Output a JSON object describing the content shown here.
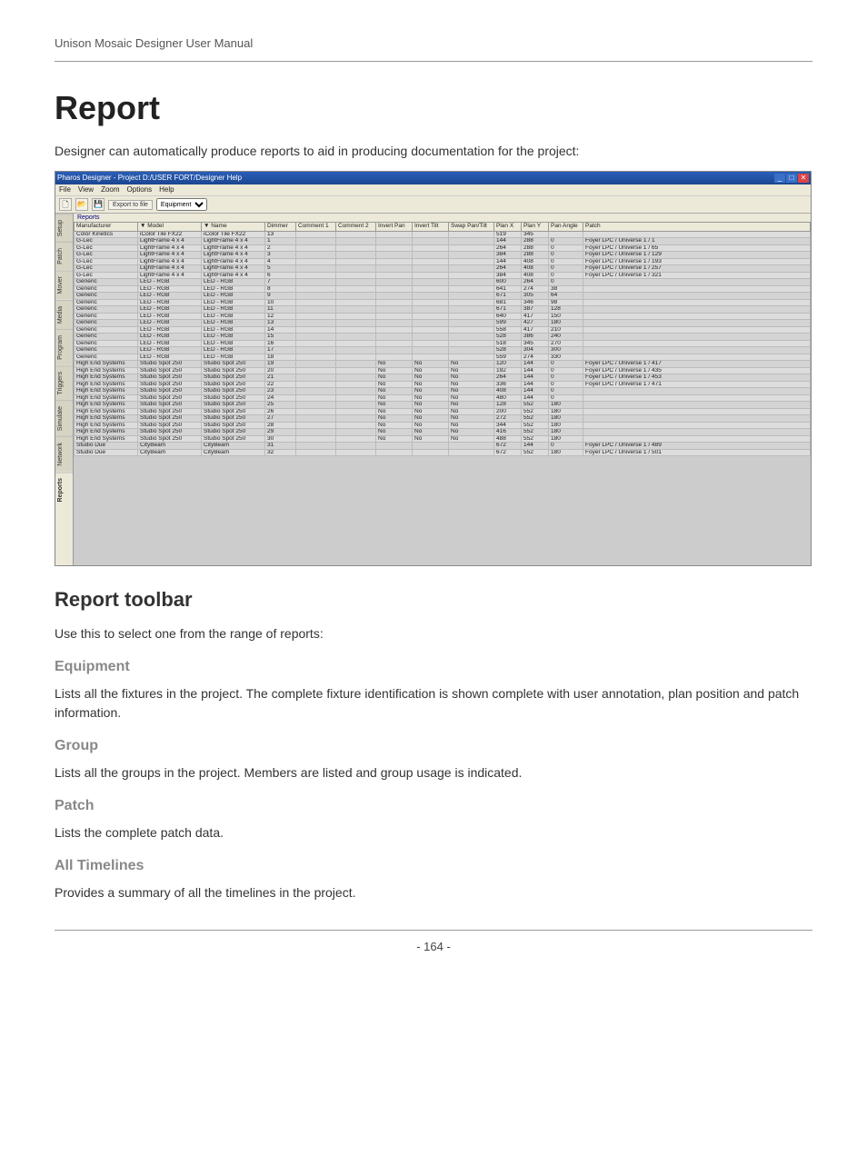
{
  "doc_header": "Unison Mosaic Designer User Manual",
  "title": "Report",
  "lead": "Designer can automatically produce reports to aid in producing documentation for the project:",
  "section_title": "Report toolbar",
  "section_lead": "Use this to select one from the range of reports:",
  "sub": {
    "equipment": {
      "title": "Equipment",
      "body": "Lists all the fixtures in the project. The complete fixture identification is shown complete with user annotation, plan position and patch information."
    },
    "group": {
      "title": "Group",
      "body": "Lists all the groups in the project. Members are listed and group usage is indicated."
    },
    "patch": {
      "title": "Patch",
      "body": "Lists the complete patch data."
    },
    "all_timelines": {
      "title": "All Timelines",
      "body": "Provides a summary of all the timelines in the project."
    }
  },
  "page_number": "- 164 -",
  "screenshot": {
    "titlebar": "Pharos Designer - Project D:/USER FORT/Designer Help",
    "menus": [
      "File",
      "View",
      "Zoom",
      "Options",
      "Help"
    ],
    "toolbar": {
      "export_label": "Export to file",
      "select_value": "Equipment"
    },
    "subtab": "Reports",
    "sidetabs": [
      "Setup",
      "Patch",
      "Mover",
      "Media",
      "Program",
      "Triggers",
      "Simulate",
      "Network",
      "Reports"
    ],
    "columns": [
      "Manufacturer",
      "▼ Model",
      "▼ Name",
      "Dimmer",
      "Comment 1",
      "Comment 2",
      "Invert Pan",
      "Invert Tilt",
      "Swap Pan/Tilt",
      "Plan X",
      "Plan Y",
      "Pan Angle",
      "Patch"
    ],
    "rows": [
      {
        "mfr": "Color Kinetics",
        "model": "iColor Tile FX22",
        "name": "iColor Tile FX22",
        "dim": "13",
        "c1": "",
        "c2": "",
        "ip": "",
        "it": "",
        "sp": "",
        "px": "519",
        "py": "345",
        "ang": "",
        "patch": ""
      },
      {
        "mfr": "G-Lec",
        "model": "LightFrame 4 x 4",
        "name": "LightFrame 4 x 4",
        "dim": "1",
        "c1": "",
        "c2": "",
        "ip": "",
        "it": "",
        "sp": "",
        "px": "144",
        "py": "288",
        "ang": "0",
        "patch": "Foyer LPC / Universe 1 / 1"
      },
      {
        "mfr": "G-Lec",
        "model": "LightFrame 4 x 4",
        "name": "LightFrame 4 x 4",
        "dim": "2",
        "c1": "",
        "c2": "",
        "ip": "",
        "it": "",
        "sp": "",
        "px": "264",
        "py": "288",
        "ang": "0",
        "patch": "Foyer LPC / Universe 1 / 65"
      },
      {
        "mfr": "G-Lec",
        "model": "LightFrame 4 x 4",
        "name": "LightFrame 4 x 4",
        "dim": "3",
        "c1": "",
        "c2": "",
        "ip": "",
        "it": "",
        "sp": "",
        "px": "384",
        "py": "288",
        "ang": "0",
        "patch": "Foyer LPC / Universe 1 / 129"
      },
      {
        "mfr": "G-Lec",
        "model": "LightFrame 4 x 4",
        "name": "LightFrame 4 x 4",
        "dim": "4",
        "c1": "",
        "c2": "",
        "ip": "",
        "it": "",
        "sp": "",
        "px": "144",
        "py": "408",
        "ang": "0",
        "patch": "Foyer LPC / Universe 1 / 193"
      },
      {
        "mfr": "G-Lec",
        "model": "LightFrame 4 x 4",
        "name": "LightFrame 4 x 4",
        "dim": "5",
        "c1": "",
        "c2": "",
        "ip": "",
        "it": "",
        "sp": "",
        "px": "264",
        "py": "408",
        "ang": "0",
        "patch": "Foyer LPC / Universe 1 / 257"
      },
      {
        "mfr": "G-Lec",
        "model": "LightFrame 4 x 4",
        "name": "LightFrame 4 x 4",
        "dim": "6",
        "c1": "",
        "c2": "",
        "ip": "",
        "it": "",
        "sp": "",
        "px": "384",
        "py": "408",
        "ang": "0",
        "patch": "Foyer LPC / Universe 1 / 321"
      },
      {
        "mfr": "Generic",
        "model": "LED - RGB",
        "name": "LED - RGB",
        "dim": "7",
        "c1": "",
        "c2": "",
        "ip": "",
        "it": "",
        "sp": "",
        "px": "600",
        "py": "264",
        "ang": "0",
        "patch": ""
      },
      {
        "mfr": "Generic",
        "model": "LED - RGB",
        "name": "LED - RGB",
        "dim": "8",
        "c1": "",
        "c2": "",
        "ip": "",
        "it": "",
        "sp": "",
        "px": "641",
        "py": "274",
        "ang": "38",
        "patch": ""
      },
      {
        "mfr": "Generic",
        "model": "LED - RGB",
        "name": "LED - RGB",
        "dim": "9",
        "c1": "",
        "c2": "",
        "ip": "",
        "it": "",
        "sp": "",
        "px": "671",
        "py": "305",
        "ang": "64",
        "patch": ""
      },
      {
        "mfr": "Generic",
        "model": "LED - RGB",
        "name": "LED - RGB",
        "dim": "10",
        "c1": "",
        "c2": "",
        "ip": "",
        "it": "",
        "sp": "",
        "px": "681",
        "py": "346",
        "ang": "98",
        "patch": ""
      },
      {
        "mfr": "Generic",
        "model": "LED - RGB",
        "name": "LED - RGB",
        "dim": "11",
        "c1": "",
        "c2": "",
        "ip": "",
        "it": "",
        "sp": "",
        "px": "671",
        "py": "387",
        "ang": "128",
        "patch": ""
      },
      {
        "mfr": "Generic",
        "model": "LED - RGB",
        "name": "LED - RGB",
        "dim": "12",
        "c1": "",
        "c2": "",
        "ip": "",
        "it": "",
        "sp": "",
        "px": "640",
        "py": "417",
        "ang": "150",
        "patch": ""
      },
      {
        "mfr": "Generic",
        "model": "LED - RGB",
        "name": "LED - RGB",
        "dim": "13",
        "c1": "",
        "c2": "",
        "ip": "",
        "it": "",
        "sp": "",
        "px": "599",
        "py": "427",
        "ang": "180",
        "patch": ""
      },
      {
        "mfr": "Generic",
        "model": "LED - RGB",
        "name": "LED - RGB",
        "dim": "14",
        "c1": "",
        "c2": "",
        "ip": "",
        "it": "",
        "sp": "",
        "px": "558",
        "py": "417",
        "ang": "210",
        "patch": ""
      },
      {
        "mfr": "Generic",
        "model": "LED - RGB",
        "name": "LED - RGB",
        "dim": "15",
        "c1": "",
        "c2": "",
        "ip": "",
        "it": "",
        "sp": "",
        "px": "528",
        "py": "386",
        "ang": "240",
        "patch": ""
      },
      {
        "mfr": "Generic",
        "model": "LED - RGB",
        "name": "LED - RGB",
        "dim": "16",
        "c1": "",
        "c2": "",
        "ip": "",
        "it": "",
        "sp": "",
        "px": "518",
        "py": "345",
        "ang": "270",
        "patch": ""
      },
      {
        "mfr": "Generic",
        "model": "LED - RGB",
        "name": "LED - RGB",
        "dim": "17",
        "c1": "",
        "c2": "",
        "ip": "",
        "it": "",
        "sp": "",
        "px": "528",
        "py": "304",
        "ang": "300",
        "patch": ""
      },
      {
        "mfr": "Generic",
        "model": "LED - RGB",
        "name": "LED - RGB",
        "dim": "18",
        "c1": "",
        "c2": "",
        "ip": "",
        "it": "",
        "sp": "",
        "px": "559",
        "py": "274",
        "ang": "330",
        "patch": ""
      },
      {
        "mfr": "High End Systems",
        "model": "Studio Spot 250",
        "name": "Studio Spot 250",
        "dim": "19",
        "c1": "",
        "c2": "",
        "ip": "No",
        "it": "No",
        "sp": "No",
        "px": "120",
        "py": "144",
        "ang": "0",
        "patch": "Foyer LPC / Universe 1 / 417"
      },
      {
        "mfr": "High End Systems",
        "model": "Studio Spot 250",
        "name": "Studio Spot 250",
        "dim": "20",
        "c1": "",
        "c2": "",
        "ip": "No",
        "it": "No",
        "sp": "No",
        "px": "192",
        "py": "144",
        "ang": "0",
        "patch": "Foyer LPC / Universe 1 / 435"
      },
      {
        "mfr": "High End Systems",
        "model": "Studio Spot 250",
        "name": "Studio Spot 250",
        "dim": "21",
        "c1": "",
        "c2": "",
        "ip": "No",
        "it": "No",
        "sp": "No",
        "px": "264",
        "py": "144",
        "ang": "0",
        "patch": "Foyer LPC / Universe 1 / 453"
      },
      {
        "mfr": "High End Systems",
        "model": "Studio Spot 250",
        "name": "Studio Spot 250",
        "dim": "22",
        "c1": "",
        "c2": "",
        "ip": "No",
        "it": "No",
        "sp": "No",
        "px": "336",
        "py": "144",
        "ang": "0",
        "patch": "Foyer LPC / Universe 1 / 471"
      },
      {
        "mfr": "High End Systems",
        "model": "Studio Spot 250",
        "name": "Studio Spot 250",
        "dim": "23",
        "c1": "",
        "c2": "",
        "ip": "No",
        "it": "No",
        "sp": "No",
        "px": "408",
        "py": "144",
        "ang": "0",
        "patch": ""
      },
      {
        "mfr": "High End Systems",
        "model": "Studio Spot 250",
        "name": "Studio Spot 250",
        "dim": "24",
        "c1": "",
        "c2": "",
        "ip": "No",
        "it": "No",
        "sp": "No",
        "px": "480",
        "py": "144",
        "ang": "0",
        "patch": ""
      },
      {
        "mfr": "High End Systems",
        "model": "Studio Spot 250",
        "name": "Studio Spot 250",
        "dim": "25",
        "c1": "",
        "c2": "",
        "ip": "No",
        "it": "No",
        "sp": "No",
        "px": "128",
        "py": "552",
        "ang": "180",
        "patch": ""
      },
      {
        "mfr": "High End Systems",
        "model": "Studio Spot 250",
        "name": "Studio Spot 250",
        "dim": "26",
        "c1": "",
        "c2": "",
        "ip": "No",
        "it": "No",
        "sp": "No",
        "px": "200",
        "py": "552",
        "ang": "180",
        "patch": ""
      },
      {
        "mfr": "High End Systems",
        "model": "Studio Spot 250",
        "name": "Studio Spot 250",
        "dim": "27",
        "c1": "",
        "c2": "",
        "ip": "No",
        "it": "No",
        "sp": "No",
        "px": "272",
        "py": "552",
        "ang": "180",
        "patch": ""
      },
      {
        "mfr": "High End Systems",
        "model": "Studio Spot 250",
        "name": "Studio Spot 250",
        "dim": "28",
        "c1": "",
        "c2": "",
        "ip": "No",
        "it": "No",
        "sp": "No",
        "px": "344",
        "py": "552",
        "ang": "180",
        "patch": ""
      },
      {
        "mfr": "High End Systems",
        "model": "Studio Spot 250",
        "name": "Studio Spot 250",
        "dim": "29",
        "c1": "",
        "c2": "",
        "ip": "No",
        "it": "No",
        "sp": "No",
        "px": "416",
        "py": "552",
        "ang": "180",
        "patch": ""
      },
      {
        "mfr": "High End Systems",
        "model": "Studio Spot 250",
        "name": "Studio Spot 250",
        "dim": "30",
        "c1": "",
        "c2": "",
        "ip": "No",
        "it": "No",
        "sp": "No",
        "px": "488",
        "py": "552",
        "ang": "180",
        "patch": ""
      },
      {
        "mfr": "Studio Due",
        "model": "CityBeam",
        "name": "CityBeam",
        "dim": "31",
        "c1": "",
        "c2": "",
        "ip": "",
        "it": "",
        "sp": "",
        "px": "672",
        "py": "144",
        "ang": "0",
        "patch": "Foyer LPC / Universe 1 / 489"
      },
      {
        "mfr": "Studio Due",
        "model": "CityBeam",
        "name": "CityBeam",
        "dim": "32",
        "c1": "",
        "c2": "",
        "ip": "",
        "it": "",
        "sp": "",
        "px": "672",
        "py": "552",
        "ang": "180",
        "patch": "Foyer LPC / Universe 1 / 501"
      }
    ]
  }
}
